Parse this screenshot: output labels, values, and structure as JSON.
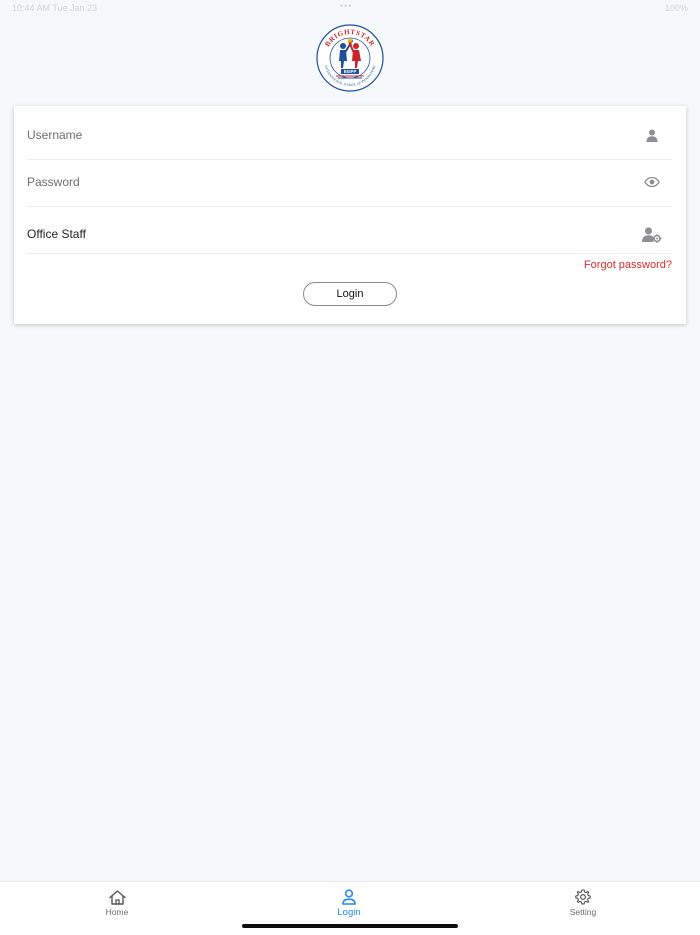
{
  "status_bar": {
    "time": "10:44 AM  Tue Jan 23",
    "center_dots": "•••",
    "right": "100%"
  },
  "logo": {
    "top_text": "BRIGHTSTAR",
    "bottom_text": "INTERNATIONAL SCHOOL OF PHNOM PENH",
    "badge_text": "BISPP"
  },
  "login_form": {
    "username": {
      "placeholder": "Username",
      "value": "",
      "icon": "user-icon"
    },
    "password": {
      "placeholder": "Password",
      "value": "",
      "icon": "eye-icon"
    },
    "role": {
      "value": "Office Staff",
      "icon": "user-gear-icon"
    },
    "forgot_password_label": "Forgot password?",
    "login_button_label": "Login"
  },
  "tab_bar": {
    "tabs": [
      {
        "label": "Home",
        "icon": "home-icon",
        "active": false
      },
      {
        "label": "Login",
        "icon": "user-icon",
        "active": true
      },
      {
        "label": "Setting",
        "icon": "gear-icon",
        "active": false
      }
    ]
  },
  "colors": {
    "background": "#f6f8fc",
    "accent": "#2489e8",
    "link_red": "#e02b2b",
    "icon_gray": "#8e8e93"
  }
}
